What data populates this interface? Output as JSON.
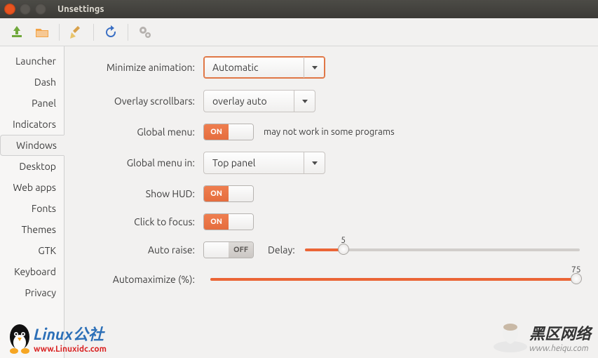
{
  "window": {
    "title": "Unsettings"
  },
  "wbtn": {
    "close_color": "#e95420",
    "min_color": "#5a5752",
    "max_color": "#5a5752"
  },
  "sidebar": {
    "items": [
      "Launcher",
      "Dash",
      "Panel",
      "Indicators",
      "Windows",
      "Desktop",
      "Web apps",
      "Fonts",
      "Themes",
      "GTK",
      "Keyboard",
      "Privacy"
    ],
    "active_index": 4
  },
  "form": {
    "minimize": {
      "label": "Minimize animation:",
      "value": "Automatic"
    },
    "overlay": {
      "label": "Overlay scrollbars:",
      "value": "overlay auto"
    },
    "globalmenu": {
      "label": "Global menu:",
      "state": "ON",
      "hint": "may not work in some programs"
    },
    "globalmenuin": {
      "label": "Global menu in:",
      "value": "Top panel"
    },
    "showhud": {
      "label": "Show HUD:",
      "state": "ON"
    },
    "clickfocus": {
      "label": "Click to focus:",
      "state": "ON"
    },
    "autoraise": {
      "label": "Auto raise:",
      "state": "OFF",
      "delay_label": "Delay:",
      "delay_value": 5,
      "delay_pct": 14
    },
    "automax": {
      "label": "Automaximize  (%):",
      "value": 75,
      "pct": 99
    }
  },
  "switch_text": {
    "on": "ON",
    "off": "OFF"
  },
  "watermarks": {
    "left": {
      "line1": "Linux公社",
      "line2": "www.Linuxidc.com"
    },
    "right": {
      "line1": "黑区网络",
      "line2": "www.heiqu.com"
    }
  }
}
